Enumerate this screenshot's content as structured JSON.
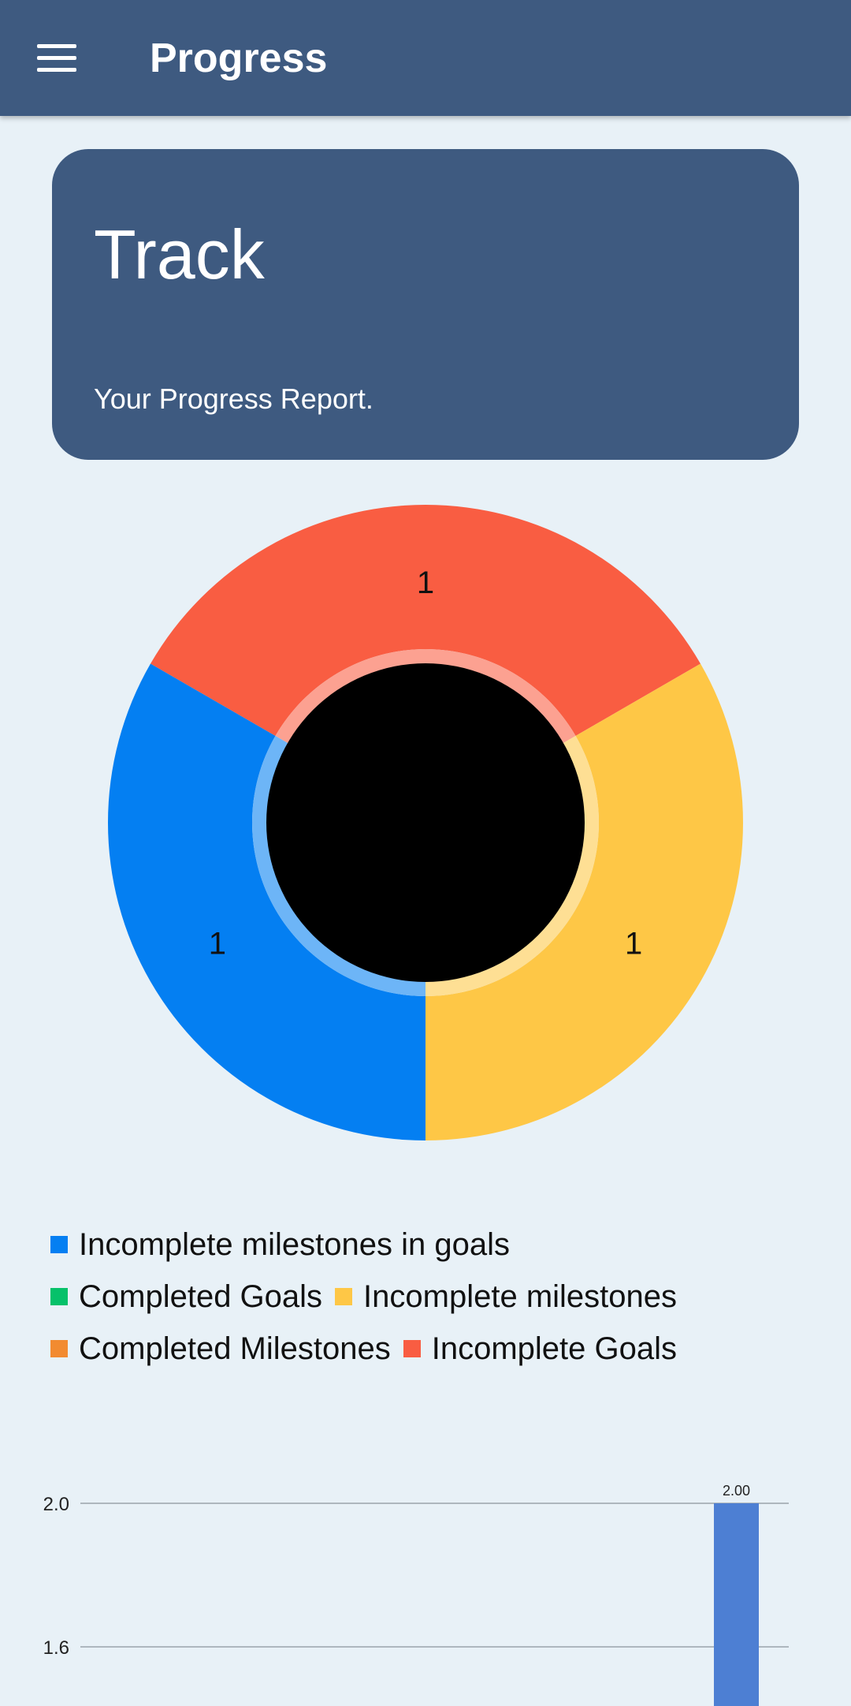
{
  "appbar": {
    "title": "Progress",
    "menu_icon": "hamburger-menu-icon"
  },
  "header_card": {
    "title": "Track",
    "subtitle": "Your Progress Report."
  },
  "chart_data": [
    {
      "type": "pie",
      "variant": "donut",
      "slices": [
        {
          "label": "Incomplete Goals",
          "value": 1,
          "color": "#f95d42"
        },
        {
          "label": "Incomplete milestones",
          "value": 1,
          "color": "#fec746"
        },
        {
          "label": "Incomplete milestones in goals",
          "value": 1,
          "color": "#047ff2"
        }
      ],
      "center_color": "#000000"
    },
    {
      "type": "bar",
      "y_ticks": [
        "2.0",
        "1.6"
      ],
      "series": [
        {
          "values": [
            2.0
          ],
          "color": "#4d7fd3"
        }
      ],
      "data_labels": [
        "2.00"
      ],
      "grid": true
    }
  ],
  "legend": {
    "rows": [
      [
        {
          "label": "Incomplete milestones in goals",
          "color": "#047ff2"
        }
      ],
      [
        {
          "label": "Completed Goals",
          "color": "#06c16a"
        },
        {
          "label": "Incomplete milestones",
          "color": "#fec746"
        }
      ],
      [
        {
          "label": "Completed Milestones",
          "color": "#f28b30"
        },
        {
          "label": "Incomplete Goals",
          "color": "#f95d42"
        }
      ]
    ]
  }
}
